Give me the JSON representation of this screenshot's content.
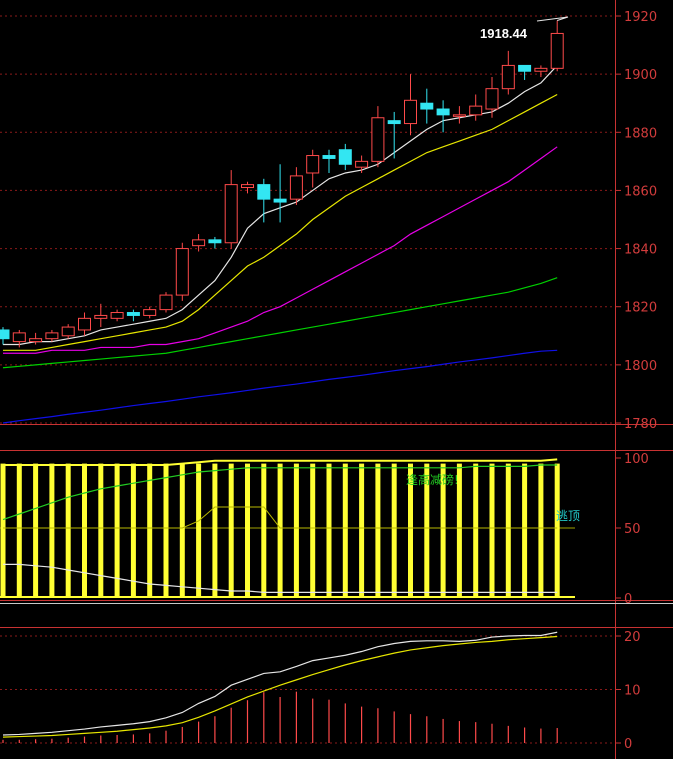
{
  "chart_data": [
    {
      "type": "candlestick",
      "title": "",
      "ylim": [
        1780,
        1923
      ],
      "yticks": [
        "1920",
        "1900",
        "1880",
        "1860",
        "1840",
        "1820",
        "1800",
        "1780"
      ],
      "grid": true,
      "annotation": {
        "label": "1918.44",
        "value": 1918.44
      },
      "candles": [
        {
          "o": 1812,
          "c": 1809,
          "h": 1813,
          "l": 1807
        },
        {
          "o": 1808,
          "c": 1811,
          "h": 1812,
          "l": 1806
        },
        {
          "o": 1808,
          "c": 1809,
          "h": 1811,
          "l": 1807
        },
        {
          "o": 1809,
          "c": 1811,
          "h": 1812,
          "l": 1808
        },
        {
          "o": 1810,
          "c": 1813,
          "h": 1814,
          "l": 1809
        },
        {
          "o": 1812,
          "c": 1816,
          "h": 1818,
          "l": 1810
        },
        {
          "o": 1816,
          "c": 1817,
          "h": 1821,
          "l": 1813
        },
        {
          "o": 1816,
          "c": 1818,
          "h": 1819,
          "l": 1815
        },
        {
          "o": 1818,
          "c": 1817,
          "h": 1819,
          "l": 1815
        },
        {
          "o": 1817,
          "c": 1819,
          "h": 1820,
          "l": 1816
        },
        {
          "o": 1819,
          "c": 1824,
          "h": 1825,
          "l": 1818
        },
        {
          "o": 1824,
          "c": 1840,
          "h": 1842,
          "l": 1822
        },
        {
          "o": 1841,
          "c": 1843,
          "h": 1845,
          "l": 1839
        },
        {
          "o": 1843,
          "c": 1842,
          "h": 1844,
          "l": 1840
        },
        {
          "o": 1842,
          "c": 1862,
          "h": 1867,
          "l": 1840
        },
        {
          "o": 1861,
          "c": 1862,
          "h": 1863,
          "l": 1859
        },
        {
          "o": 1862,
          "c": 1857,
          "h": 1864,
          "l": 1849
        },
        {
          "o": 1857,
          "c": 1856,
          "h": 1869,
          "l": 1849
        },
        {
          "o": 1857,
          "c": 1865,
          "h": 1868,
          "l": 1855
        },
        {
          "o": 1866,
          "c": 1872,
          "h": 1874,
          "l": 1861
        },
        {
          "o": 1872,
          "c": 1871,
          "h": 1874,
          "l": 1866
        },
        {
          "o": 1874,
          "c": 1869,
          "h": 1876,
          "l": 1867
        },
        {
          "o": 1868,
          "c": 1870,
          "h": 1872,
          "l": 1866
        },
        {
          "o": 1870,
          "c": 1885,
          "h": 1889,
          "l": 1868
        },
        {
          "o": 1884,
          "c": 1883,
          "h": 1887,
          "l": 1871
        },
        {
          "o": 1883,
          "c": 1891,
          "h": 1900,
          "l": 1879
        },
        {
          "o": 1890,
          "c": 1888,
          "h": 1895,
          "l": 1883
        },
        {
          "o": 1888,
          "c": 1886,
          "h": 1891,
          "l": 1880
        },
        {
          "o": 1886,
          "c": 1886,
          "h": 1889,
          "l": 1883
        },
        {
          "o": 1886,
          "c": 1889,
          "h": 1893,
          "l": 1884
        },
        {
          "o": 1888,
          "c": 1895,
          "h": 1899,
          "l": 1885
        },
        {
          "o": 1895,
          "c": 1903,
          "h": 1908,
          "l": 1893
        },
        {
          "o": 1903,
          "c": 1901,
          "h": 1903,
          "l": 1898
        },
        {
          "o": 1901,
          "c": 1902,
          "h": 1903,
          "l": 1899
        },
        {
          "o": 1902,
          "c": 1914,
          "h": 1918.44,
          "l": 1901
        }
      ],
      "ma_series": [
        {
          "color": "#e6e6e6",
          "values": [
            1807,
            1807,
            1808,
            1808,
            1809,
            1810,
            1812,
            1813,
            1814,
            1815,
            1816,
            1819,
            1824,
            1829,
            1837,
            1847,
            1852,
            1854,
            1856,
            1860,
            1864,
            1866,
            1867,
            1869,
            1873,
            1877,
            1881,
            1884,
            1885,
            1886,
            1887,
            1890,
            1894,
            1897,
            1903
          ]
        },
        {
          "color": "#e6e600",
          "values": [
            1805,
            1805,
            1805,
            1806,
            1807,
            1808,
            1809,
            1810,
            1811,
            1812,
            1813,
            1815,
            1819,
            1824,
            1829,
            1834,
            1837,
            1841,
            1845,
            1850,
            1854,
            1858,
            1861,
            1864,
            1867,
            1870,
            1873,
            1875,
            1877,
            1879,
            1881,
            1884,
            1887,
            1890,
            1893
          ]
        },
        {
          "color": "#e600e6",
          "values": [
            1804,
            1804,
            1804,
            1805,
            1805,
            1805,
            1806,
            1806,
            1806,
            1807,
            1807,
            1808,
            1809,
            1811,
            1813,
            1815,
            1818,
            1820,
            1823,
            1826,
            1829,
            1832,
            1835,
            1838,
            1841,
            1845,
            1848,
            1851,
            1854,
            1857,
            1860,
            1863,
            1867,
            1871,
            1875
          ]
        },
        {
          "color": "#00d000",
          "values": [
            1799,
            1799.5,
            1800,
            1800.5,
            1801,
            1801.5,
            1802,
            1802.5,
            1803,
            1803.5,
            1804,
            1805,
            1806,
            1807,
            1808,
            1809,
            1810,
            1811,
            1812,
            1813,
            1814,
            1815,
            1816,
            1817,
            1818,
            1819,
            1820,
            1821,
            1822,
            1823,
            1824,
            1825,
            1826.5,
            1828,
            1830
          ]
        },
        {
          "color": "#1010e8",
          "values": [
            1780,
            1780.8,
            1781.5,
            1782.2,
            1783,
            1783.7,
            1784.4,
            1785.2,
            1786,
            1786.7,
            1787.4,
            1788.2,
            1789,
            1789.7,
            1790.4,
            1791.2,
            1792,
            1792.7,
            1793.4,
            1794.2,
            1795,
            1795.7,
            1796.4,
            1797.2,
            1798,
            1798.7,
            1799.4,
            1800.2,
            1801,
            1801.7,
            1802.4,
            1803.2,
            1804,
            1804.7,
            1805
          ]
        }
      ]
    },
    {
      "type": "bar",
      "ylim": [
        0,
        104
      ],
      "yticks": [
        "100",
        "50",
        "0"
      ],
      "signal_top": "逢高减磅!",
      "signal_mid": "逃顶",
      "bars": [
        96,
        96,
        96,
        96,
        96,
        96,
        96,
        96,
        96,
        96,
        96,
        96,
        96,
        96,
        96,
        96,
        96,
        96,
        96,
        96,
        96,
        96,
        96,
        96,
        96,
        96,
        96,
        96,
        96,
        96,
        96,
        96,
        96,
        96,
        96
      ],
      "top_line": [
        95,
        95,
        95,
        95,
        95,
        95,
        95,
        95,
        95,
        95,
        95,
        96,
        97,
        98,
        98,
        98,
        98,
        98,
        98,
        98,
        98,
        98,
        98,
        98,
        98,
        98,
        98,
        98,
        98,
        98,
        98,
        98,
        98,
        98,
        99
      ],
      "green_line": [
        56,
        60,
        64,
        68,
        72,
        75,
        78,
        80,
        82,
        84,
        86,
        88,
        90,
        91,
        92,
        93,
        93,
        93,
        93,
        93,
        93,
        93,
        93,
        93,
        93,
        93,
        93,
        93,
        93,
        94,
        94,
        94,
        94,
        95,
        95
      ],
      "white_line": [
        24,
        24,
        23,
        22,
        20,
        18,
        16,
        14,
        12,
        10,
        9,
        8,
        7,
        6,
        5,
        5,
        4,
        4,
        4,
        4,
        4,
        4,
        4,
        4,
        4,
        4,
        4,
        4,
        4,
        4,
        4,
        4,
        4,
        4,
        4
      ],
      "thin_line": [
        50,
        50,
        50,
        50,
        50,
        50,
        50,
        50,
        50,
        50,
        50,
        50,
        55,
        65,
        65,
        65,
        65,
        50,
        50,
        50,
        50,
        50,
        50,
        50,
        50,
        50,
        50,
        50,
        50,
        50,
        50,
        50,
        50,
        50,
        50
      ]
    },
    {
      "type": "line",
      "ylim": [
        -1,
        21
      ],
      "yticks": [
        "20",
        "10",
        "0"
      ],
      "white_line": [
        1.5,
        1.6,
        1.8,
        2.0,
        2.3,
        2.6,
        3.0,
        3.3,
        3.6,
        4.0,
        4.7,
        5.7,
        7.4,
        8.7,
        10.8,
        11.9,
        13.0,
        13.3,
        14.3,
        15.4,
        15.9,
        16.4,
        17.1,
        18.0,
        18.6,
        19.0,
        19.1,
        19.1,
        19.0,
        19.2,
        19.8,
        20.0,
        20.1,
        20.1,
        20.7
      ],
      "yellow_line": [
        1.1,
        1.2,
        1.3,
        1.4,
        1.6,
        1.8,
        2.0,
        2.2,
        2.5,
        2.8,
        3.2,
        3.8,
        4.8,
        6.0,
        7.3,
        8.6,
        9.7,
        10.8,
        11.8,
        12.8,
        13.7,
        14.6,
        15.4,
        16.1,
        16.8,
        17.4,
        17.8,
        18.2,
        18.5,
        18.8,
        19.0,
        19.3,
        19.5,
        19.7,
        19.9
      ],
      "bars": [
        0.6,
        0.6,
        0.7,
        0.8,
        1.0,
        1.2,
        1.4,
        1.5,
        1.6,
        1.8,
        2.3,
        3.0,
        4.0,
        5.0,
        6.6,
        8.0,
        9.5,
        8.6,
        9.6,
        8.3,
        8.1,
        7.4,
        6.8,
        6.5,
        5.9,
        5.4,
        5.0,
        4.5,
        4.1,
        3.9,
        3.6,
        3.2,
        2.9,
        2.7,
        2.8
      ]
    }
  ]
}
